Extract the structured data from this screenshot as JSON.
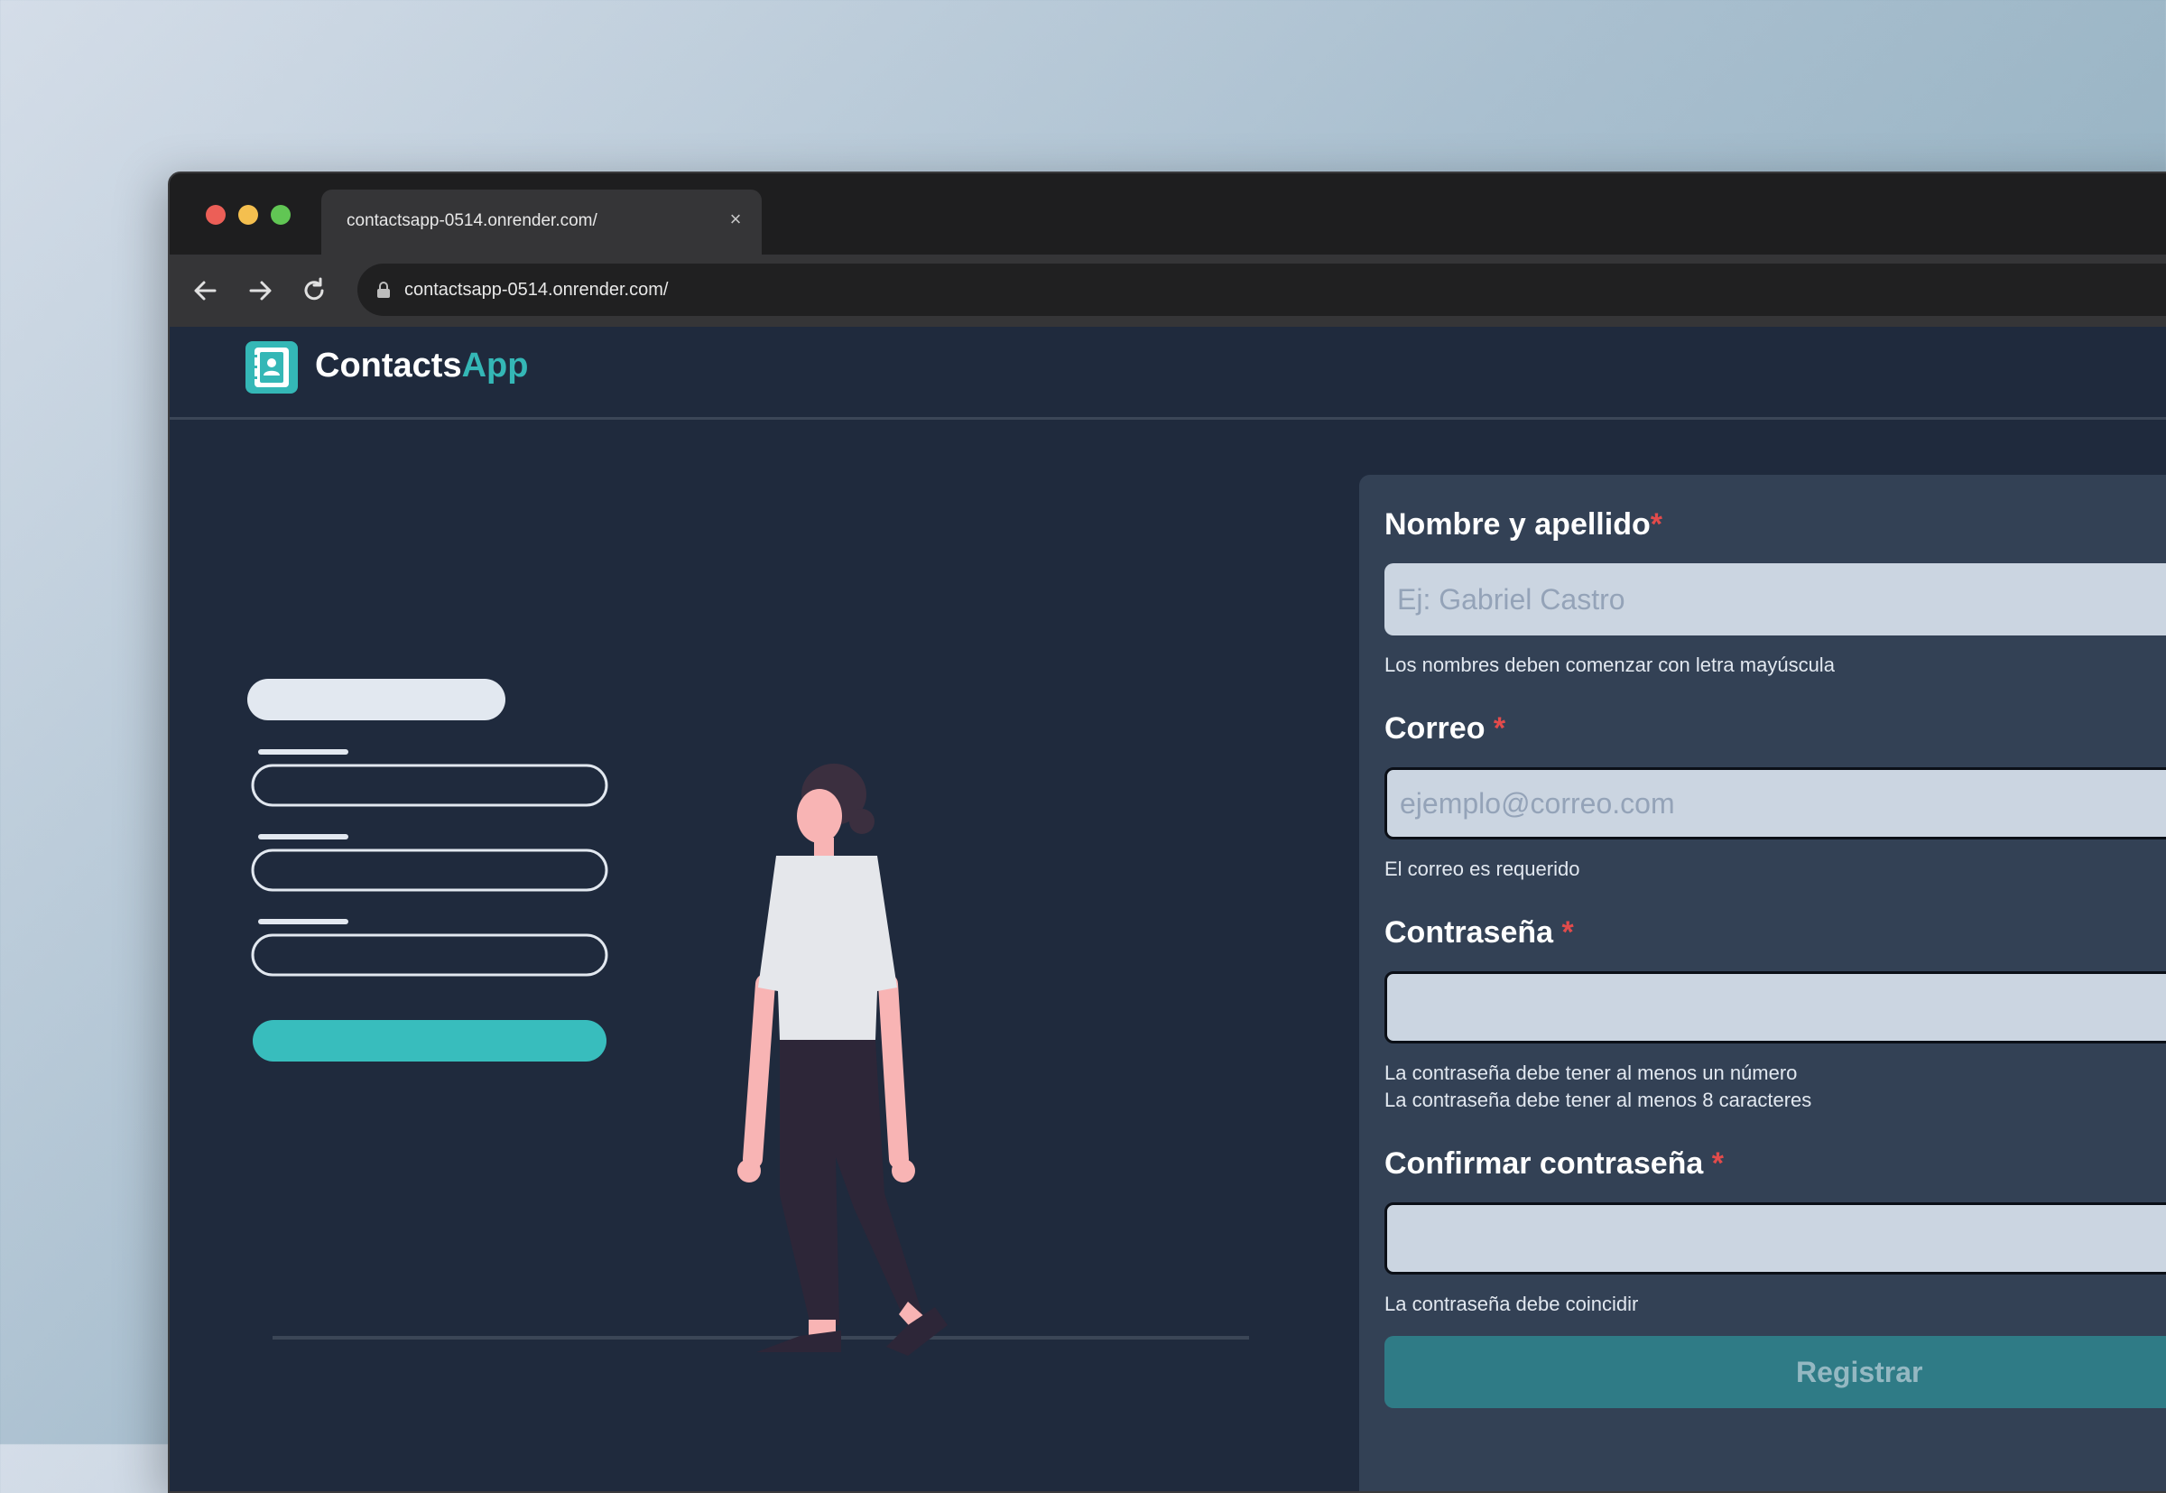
{
  "browser": {
    "tab_title": "contactsapp-0514.onrender.com/",
    "tab_close_icon": "×",
    "url": "contactsapp-0514.onrender.com/"
  },
  "app": {
    "brand_primary": "Contacts",
    "brand_accent": "App",
    "accent_color": "#34b7b6"
  },
  "form": {
    "fields": [
      {
        "label": "Nombre y apellido",
        "required_mark": "*",
        "placeholder": "Ej: Gabriel Castro",
        "value": "",
        "help": [
          "Los nombres deben comenzar con letra mayúscula"
        ]
      },
      {
        "label": "Correo",
        "required_mark": "*",
        "placeholder": "ejemplo@correo.com",
        "value": "",
        "help": [
          "El correo es requerido"
        ]
      },
      {
        "label": "Contraseña",
        "required_mark": "*",
        "placeholder": "",
        "value": "",
        "help": [
          "La contraseña debe tener al menos un número",
          "La contraseña debe tener al menos 8 caracteres"
        ]
      },
      {
        "label": "Confirmar contraseña",
        "required_mark": "*",
        "placeholder": "",
        "value": "",
        "help": [
          "La contraseña debe coincidir"
        ]
      }
    ],
    "submit_label": "Registrar"
  }
}
